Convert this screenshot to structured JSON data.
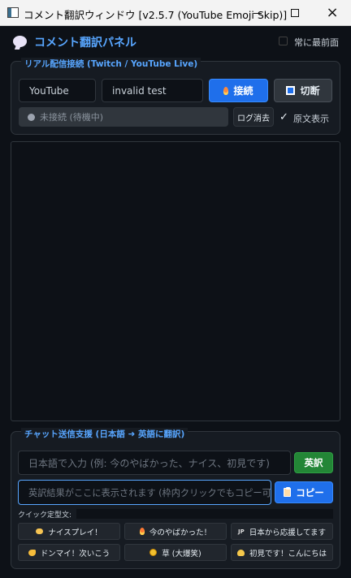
{
  "window": {
    "title": "コメント翻訳ウィンドウ [v2.5.7 (YouTube Emoji Skip)]",
    "controls": {
      "minimize": "—",
      "maximize": "□",
      "close": "×"
    }
  },
  "header": {
    "icon": "speech-bubble-icon",
    "title": "コメント翻訳パネル",
    "topmost_label": "常に最前面",
    "topmost_checked": false
  },
  "connection": {
    "section_label": "リアル配信接続 (Twitch / YouTube Live)",
    "platform": "YouTube",
    "channel_value": "invalid test",
    "connect_label": "接続",
    "connect_icon": "flame-icon",
    "disconnect_label": "切断",
    "disconnect_icon": "stop-icon",
    "status_text": "未接続 (待機中)",
    "log_clear_label": "ログ消去",
    "original_checkmark": "✓",
    "original_label": "原文表示"
  },
  "chat_support": {
    "section_label": "チャット送信支援 (日本語 ➜ 英語に翻訳)",
    "japanese_placeholder": "日本語で入力 (例: 今のやばかった、ナイス、初見です)",
    "translate_label": "英訳",
    "result_placeholder": "英訳結果がここに表示されます (枠内クリックでもコピー可能)",
    "copy_label": "コピー",
    "copy_icon": "clipboard-icon",
    "quick_phrase_label": "クイック定型文:",
    "quick_phrases": [
      {
        "label": "ナイスプレイ！",
        "icon": "clap-icon"
      },
      {
        "label": "今のやばかった！",
        "icon": "fire-icon"
      },
      {
        "label": "日本から応援してます",
        "icon": "jp-flag-icon",
        "badge": "JP"
      },
      {
        "label": "ドンマイ！次いこう",
        "icon": "strong-arm-icon"
      },
      {
        "label": "草 (大爆笑)",
        "icon": "laughing-face-icon"
      },
      {
        "label": "初見です！こんにちは",
        "icon": "wave-icon"
      }
    ]
  },
  "colors": {
    "background": "#0d1117",
    "panel": "#161b22",
    "border": "#30363d",
    "accent": "#58a6ff",
    "primary_button": "#1f6feb",
    "success_button": "#238636",
    "muted_text": "#8b949e"
  }
}
